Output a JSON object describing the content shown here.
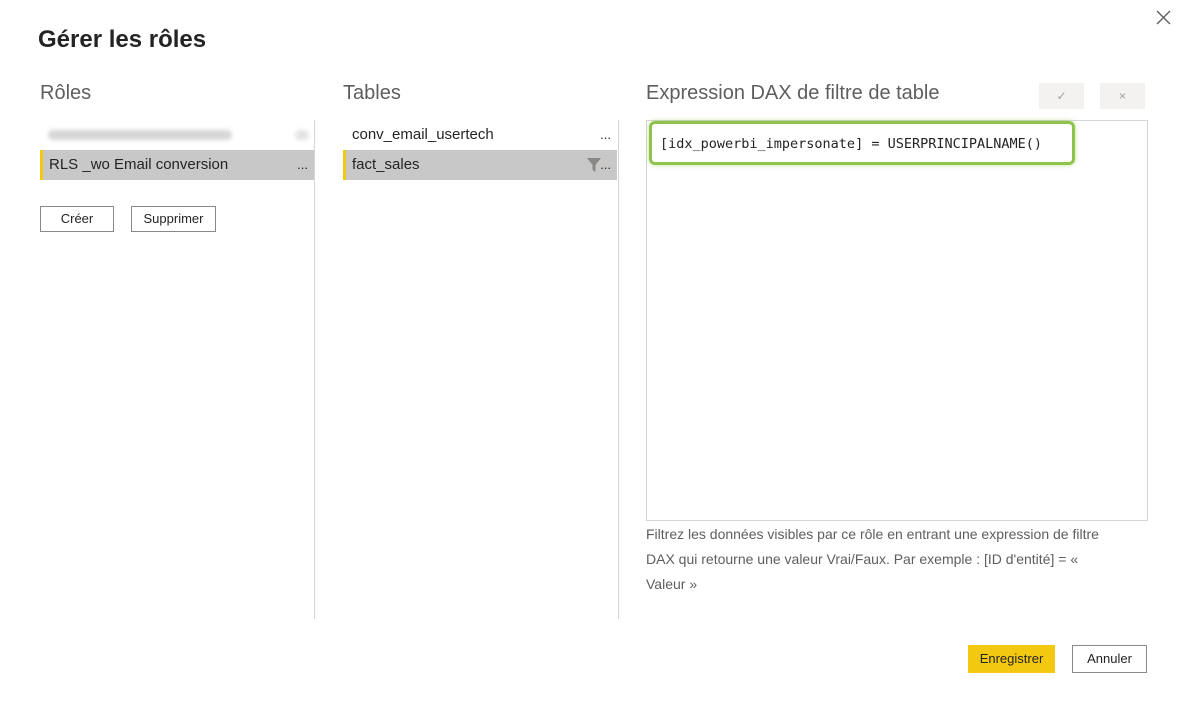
{
  "dialog": {
    "title": "Gérer les rôles",
    "close_icon": "close-icon"
  },
  "roles": {
    "heading": "Rôles",
    "items": [
      {
        "label": "",
        "redacted": true
      },
      {
        "label": "RLS _wo Email conversion",
        "more": "...",
        "selected": true
      }
    ],
    "create_label": "Créer",
    "delete_label": "Supprimer"
  },
  "tables": {
    "heading": "Tables",
    "items": [
      {
        "label": "conv_email_usertech",
        "more": "..."
      },
      {
        "label": "fact_sales",
        "more": "...",
        "selected": true,
        "has_filter": true,
        "filter_icon": "filter-icon"
      }
    ]
  },
  "expression": {
    "heading": "Expression DAX de filtre de table",
    "check_label": "✓",
    "cancel_label": "×",
    "code": "[idx_powerbi_impersonate] = USERPRINCIPALNAME()",
    "help": "Filtrez les données visibles par ce rôle en entrant une expression de filtre DAX qui retourne une valeur Vrai/Faux. Par exemple : [ID d'entité] = « Valeur »"
  },
  "footer": {
    "save_label": "Enregistrer",
    "cancel_label": "Annuler"
  },
  "colors": {
    "accent": "#f2c811",
    "highlight": "#8fc44a",
    "selected_bg": "#c8c8c8"
  }
}
